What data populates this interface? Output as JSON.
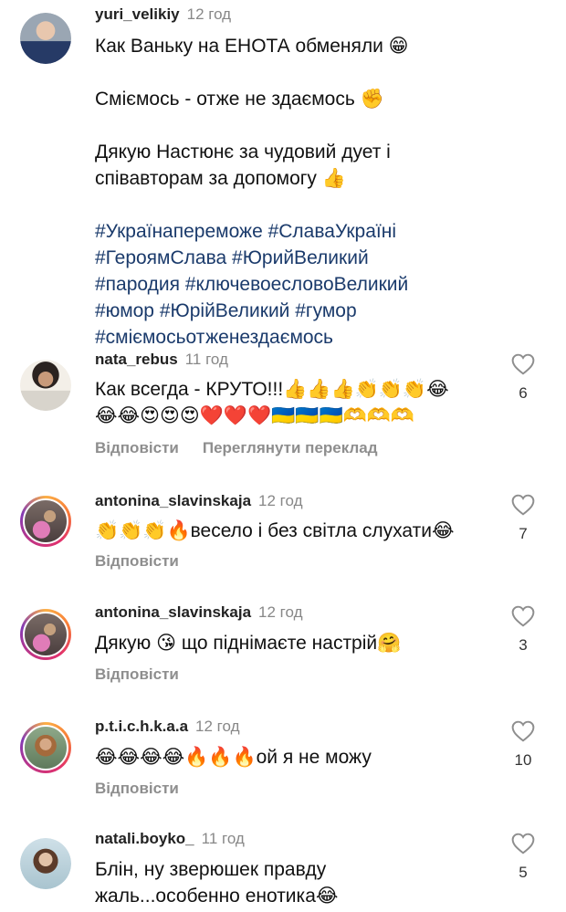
{
  "post": {
    "username": "yuri_velikiy",
    "time": "12 год",
    "line1": "Как Ваньку на ЕНОТА обменяли 😁",
    "line2": "Сміємось - отже не здаємось ✊",
    "line3a": "Дякую Настюнє за чудовий дует і",
    "line3b": "співавторам за допомогу 👍",
    "tags": [
      "#Українапереможе #СлаваУкраїні",
      "#ГероямСлава #ЮрийВеликий",
      "#пародия #ключевоесловоВеликий",
      "#юмор #ЮрійВеликий #гумор",
      "#сміємосьотженездаємось"
    ]
  },
  "comments": [
    {
      "username": "nata_rebus",
      "time": "11 год",
      "line1": "Как всегда - КРУТО!!!👍👍👍👏👏👏😂",
      "line2": "😂😂😍😍😍❤️❤️❤️🇺🇦🇺🇦🇺🇦🫶🫶🫶",
      "reply": "Відповісти",
      "translate": "Переглянути переклад",
      "likes": "6"
    },
    {
      "username": "antonina_slavinskaja",
      "time": "12 год",
      "line1": "👏👏👏🔥весело і без світла слухати😂",
      "reply": "Відповісти",
      "likes": "7"
    },
    {
      "username": "antonina_slavinskaja",
      "time": "12 год",
      "line1": "Дякую 😘 що піднімаєте настрій🤗",
      "reply": "Відповісти",
      "likes": "3"
    },
    {
      "username": "p.t.i.c.h.k.a.a",
      "time": "12 год",
      "line1": "😂😂😂😂🔥🔥🔥ой я не можу",
      "reply": "Відповісти",
      "likes": "10"
    },
    {
      "username": "natali.boyko_",
      "time": "11 год",
      "line1": "Блін, ну зверюшек правду",
      "line2": "жаль...особенно енотика😂",
      "likes": "5"
    }
  ],
  "icons": {
    "like": "heart-outline-icon"
  },
  "colors": {
    "link": "#1a3a6b",
    "muted": "#8e8e8e",
    "story_ring": "#e1306c"
  }
}
